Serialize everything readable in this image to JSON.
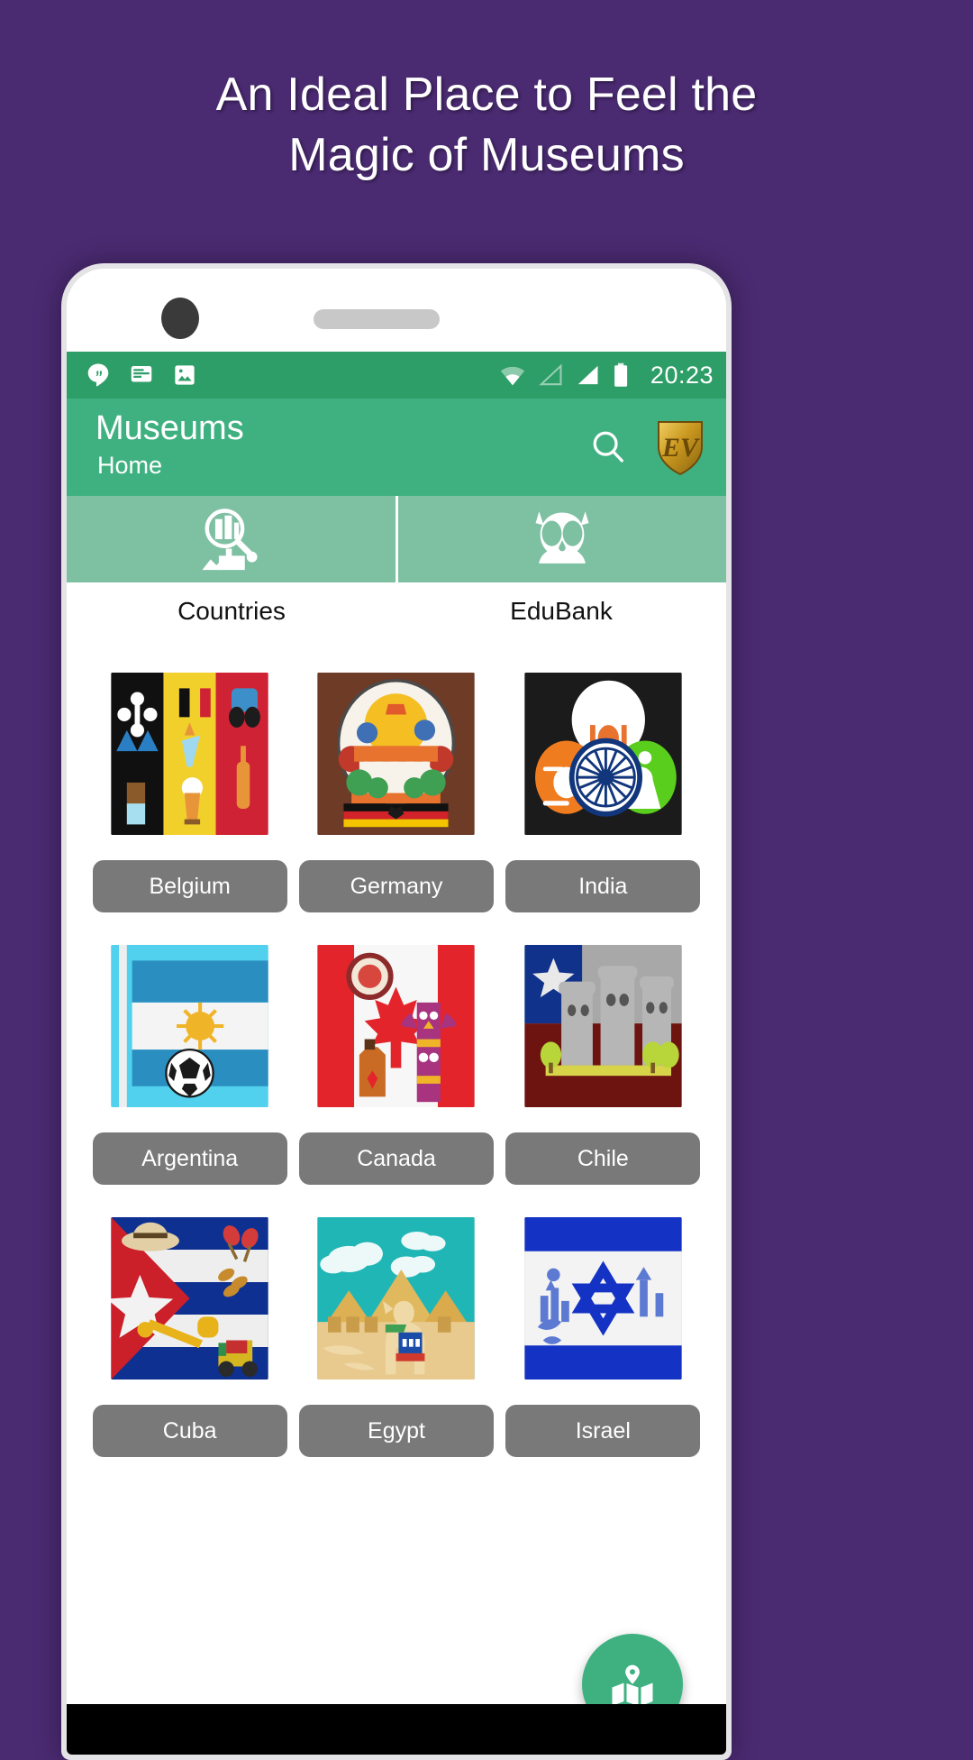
{
  "promo": {
    "headline_line1": "An Ideal Place to Feel the",
    "headline_line2": "Magic of Museums"
  },
  "colors": {
    "background_purple": "#4a2a71",
    "statusbar_green": "#2e9e68",
    "appbar_green": "#3fb181",
    "tabstrip_green": "#7ec0a2",
    "chip_gray": "#797979",
    "fab_green": "#3fb181",
    "navbar_black": "#000000",
    "brand_gold": "#d8a72a"
  },
  "statusbar": {
    "clock": "20:23",
    "left_icons": [
      "hangouts-icon",
      "message-icon",
      "photo-icon"
    ],
    "right_icons": [
      "wifi-icon",
      "signal-empty-icon",
      "signal-full-icon",
      "battery-icon"
    ]
  },
  "appbar": {
    "title": "Museums",
    "subtitle": "Home",
    "search_icon": "search-icon",
    "brand_logo": "ev-shield-logo",
    "brand_text": "EV"
  },
  "tabs": [
    {
      "label": "Countries",
      "icon": "magnifier-building-icon",
      "selected": true
    },
    {
      "label": "EduBank",
      "icon": "owl-icon",
      "selected": false
    }
  ],
  "countries": [
    [
      {
        "name": "Belgium",
        "thumb": "belgium-thumb"
      },
      {
        "name": "Germany",
        "thumb": "germany-thumb"
      },
      {
        "name": "India",
        "thumb": "india-thumb"
      }
    ],
    [
      {
        "name": "Argentina",
        "thumb": "argentina-thumb"
      },
      {
        "name": "Canada",
        "thumb": "canada-thumb"
      },
      {
        "name": "Chile",
        "thumb": "chile-thumb"
      }
    ],
    [
      {
        "name": "Cuba",
        "thumb": "cuba-thumb"
      },
      {
        "name": "Egypt",
        "thumb": "egypt-thumb"
      },
      {
        "name": "Israel",
        "thumb": "israel-thumb"
      }
    ]
  ],
  "fab": {
    "icon": "map-location-icon"
  }
}
